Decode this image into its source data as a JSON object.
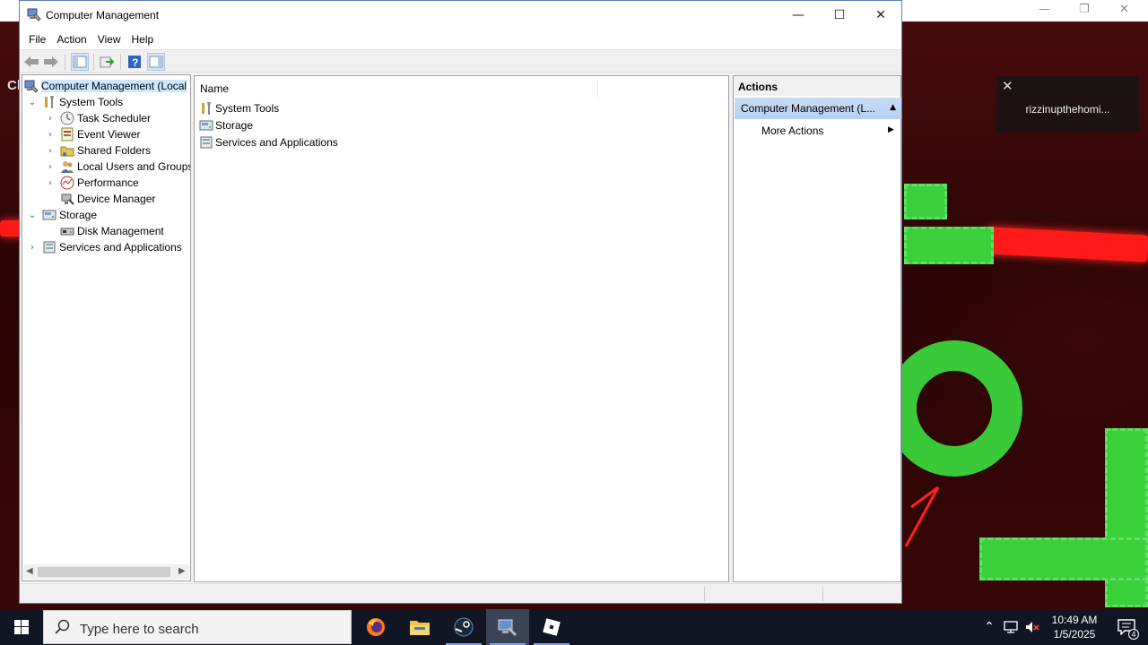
{
  "window": {
    "title": "Computer Management",
    "controls": {
      "minimize": "—",
      "maximize": "☐",
      "close": "✕"
    }
  },
  "menu": [
    "File",
    "Action",
    "View",
    "Help"
  ],
  "toolbar": [
    "back-icon",
    "forward-icon",
    "show-hide-console-tree-icon",
    "export-list-icon",
    "help-icon",
    "show-hide-action-pane-icon"
  ],
  "tree": {
    "root": "Computer Management (Local",
    "items": [
      {
        "label": "System Tools",
        "expanded": true
      },
      {
        "label": "Task Scheduler"
      },
      {
        "label": "Event Viewer"
      },
      {
        "label": "Shared Folders"
      },
      {
        "label": "Local Users and Groups"
      },
      {
        "label": "Performance"
      },
      {
        "label": "Device Manager"
      },
      {
        "label": "Storage",
        "expanded": true
      },
      {
        "label": "Disk Management"
      },
      {
        "label": "Services and Applications"
      }
    ]
  },
  "list": {
    "column": "Name",
    "items": [
      "System Tools",
      "Storage",
      "Services and Applications"
    ]
  },
  "actions": {
    "header": "Actions",
    "selected": "Computer Management (L...",
    "item": "More Actions"
  },
  "background": {
    "partial_text": "Cl",
    "toast": "rizzinupthehomi..."
  },
  "taskbar": {
    "search_placeholder": "Type here to search",
    "apps": [
      "firefox-icon",
      "file-explorer-icon",
      "steam-icon",
      "computer-management-icon",
      "roblox-icon"
    ],
    "time": "10:49 AM",
    "date": "1/5/2025",
    "notification_count": "4"
  },
  "colors": {
    "accent": "#3399ff",
    "taskbar": "#101623",
    "selection": "#cce8ff"
  }
}
